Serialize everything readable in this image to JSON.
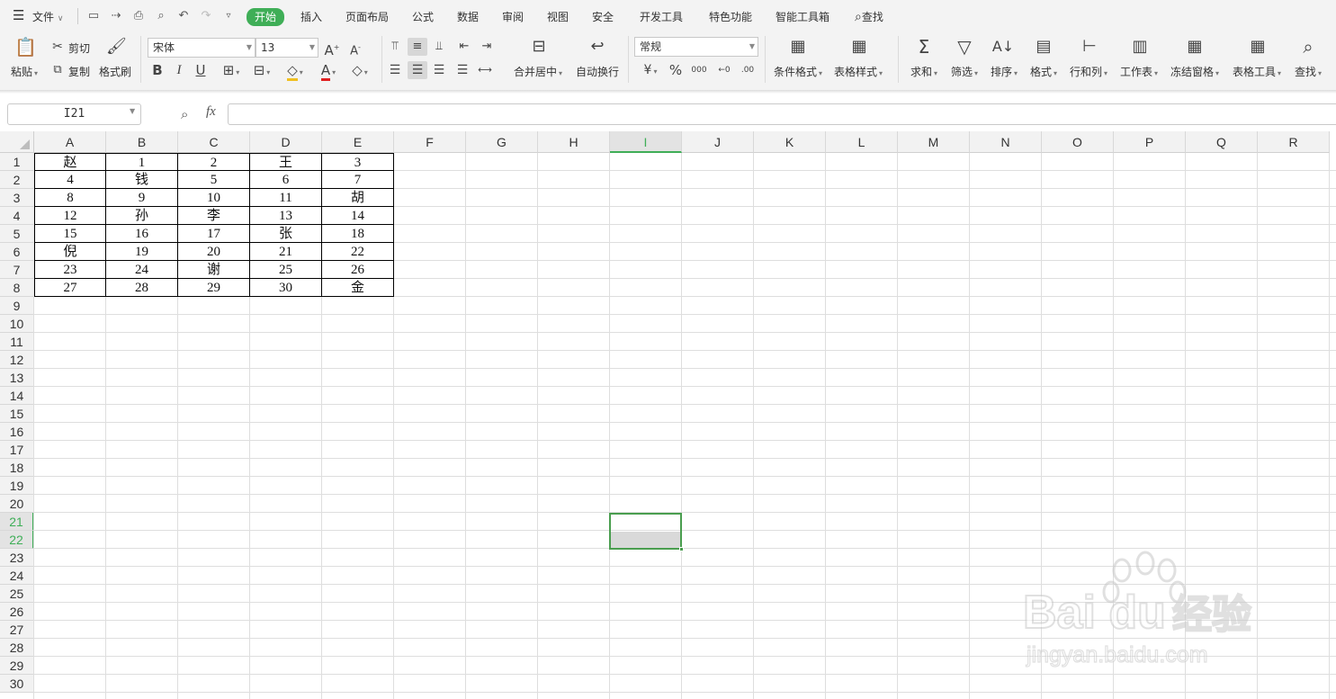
{
  "menu": {
    "file": "文件",
    "tabs": [
      "开始",
      "插入",
      "页面布局",
      "公式",
      "数据",
      "审阅",
      "视图",
      "安全",
      "开发工具",
      "特色功能",
      "智能工具箱"
    ],
    "active_tab": "开始",
    "search": "查找"
  },
  "ribbon": {
    "paste": "粘贴",
    "cut": "剪切",
    "copy": "复制",
    "format_painter": "格式刷",
    "font_name": "宋体",
    "font_size": "13",
    "merge_center": "合并居中",
    "wrap_text": "自动换行",
    "number_format": "常规",
    "conditional_format": "条件格式",
    "table_style": "表格样式",
    "sum": "求和",
    "filter": "筛选",
    "sort": "排序",
    "format": "格式",
    "row_col": "行和列",
    "worksheet": "工作表",
    "freeze": "冻结窗格",
    "table_tools": "表格工具",
    "find": "查找"
  },
  "formula_bar": {
    "name_box": "I21",
    "fx": "fx",
    "value": ""
  },
  "sheet": {
    "columns": [
      "A",
      "B",
      "C",
      "D",
      "E",
      "F",
      "G",
      "H",
      "I",
      "J",
      "K",
      "L",
      "M",
      "N",
      "O",
      "P",
      "Q",
      "R"
    ],
    "active_column": "I",
    "active_rows": [
      21,
      22
    ],
    "rows": [
      "1",
      "2",
      "3",
      "4",
      "5",
      "6",
      "7",
      "8",
      "9",
      "10",
      "11",
      "12",
      "13",
      "14",
      "15",
      "16",
      "17",
      "18",
      "19",
      "20",
      "21",
      "22",
      "23",
      "24",
      "25",
      "26",
      "27",
      "28",
      "29",
      "30"
    ],
    "cells": [
      [
        "赵",
        "1",
        "2",
        "王",
        "3"
      ],
      [
        "4",
        "钱",
        "5",
        "6",
        "7"
      ],
      [
        "8",
        "9",
        "10",
        "11",
        "胡"
      ],
      [
        "12",
        "孙",
        "李",
        "13",
        "14"
      ],
      [
        "15",
        "16",
        "17",
        "张",
        "18"
      ],
      [
        "倪",
        "19",
        "20",
        "21",
        "22"
      ],
      [
        "23",
        "24",
        "谢",
        "25",
        "26"
      ],
      [
        "27",
        "28",
        "29",
        "30",
        "金"
      ]
    ]
  },
  "watermark": {
    "brand": "Bai du",
    "cn": "经验",
    "url": "jingyan.baidu.com"
  },
  "colors": {
    "accent": "#3fae57",
    "selection": "#4a9e4f"
  }
}
